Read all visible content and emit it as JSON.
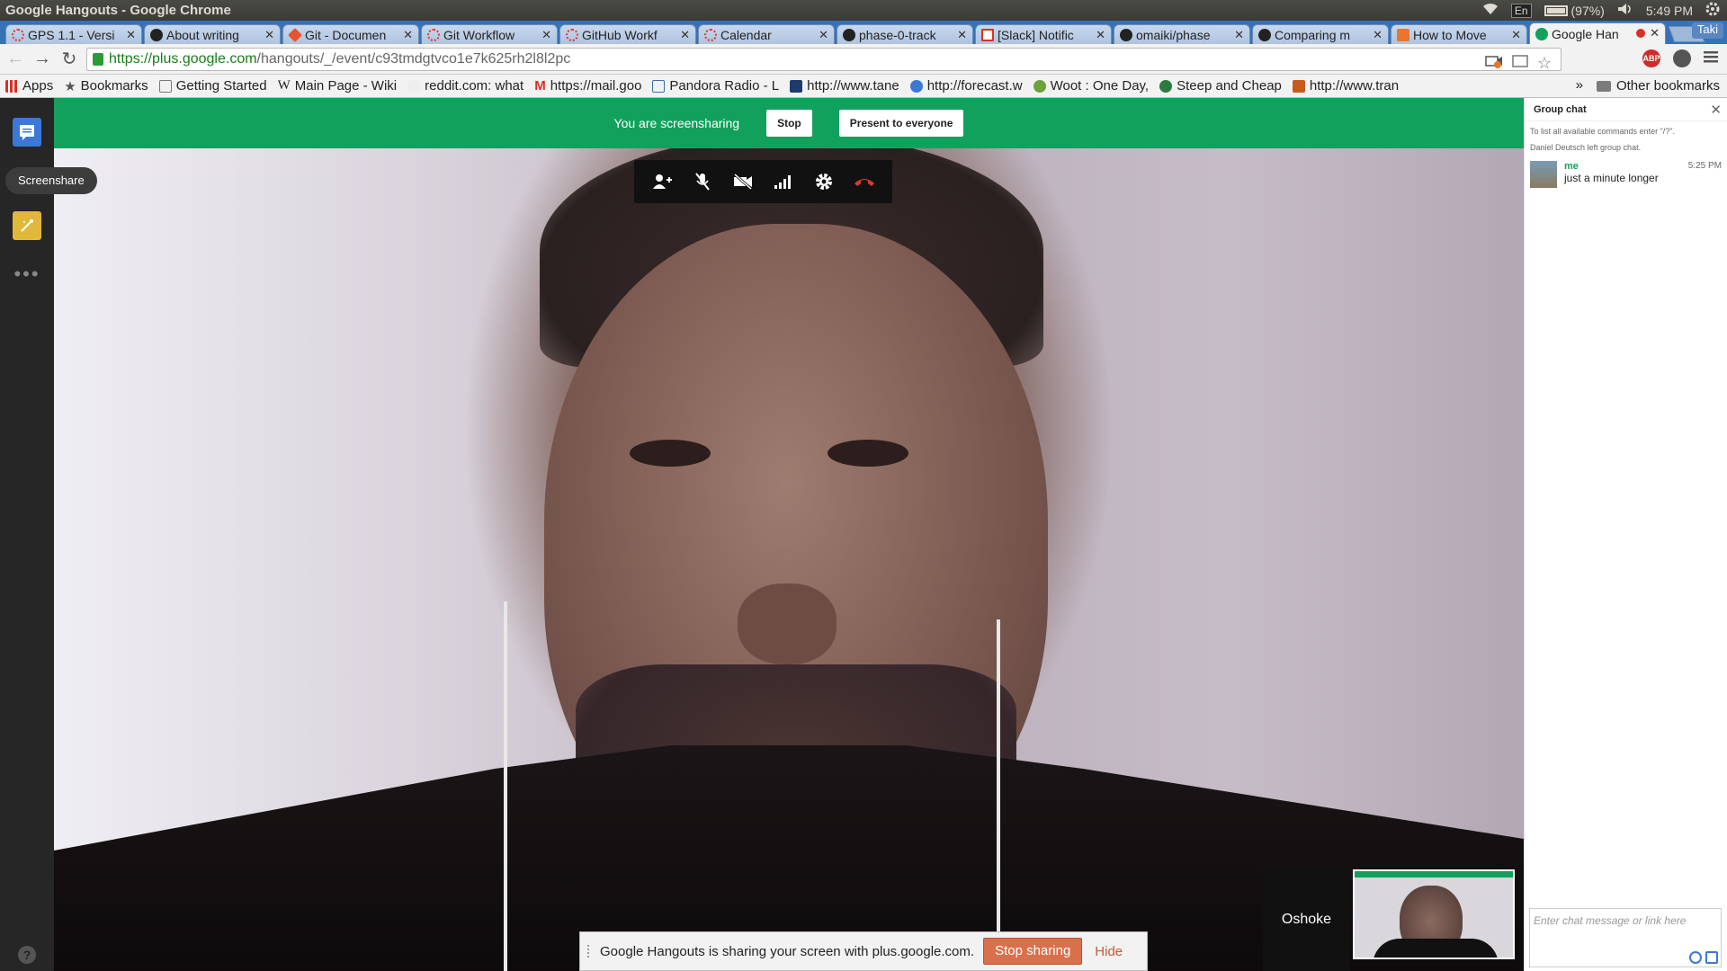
{
  "os": {
    "window_title": "Google Hangouts - Google Chrome",
    "language": "En",
    "battery": "(97%)",
    "clock": "5:49 PM"
  },
  "browser": {
    "tabs": [
      {
        "label": "GPS 1.1 - Versi",
        "color": "#e0392b"
      },
      {
        "label": "About writing",
        "color": "#222222"
      },
      {
        "label": "Git - Documen",
        "color": "#e8532c"
      },
      {
        "label": "Git Workflow",
        "color": "#e0392b"
      },
      {
        "label": "GitHub Workf",
        "color": "#e0392b"
      },
      {
        "label": "Calendar",
        "color": "#e0392b"
      },
      {
        "label": "phase-0-track",
        "color": "#222222"
      },
      {
        "label": "[Slack] Notific",
        "color": "#d93025"
      },
      {
        "label": "omaiki/phase",
        "color": "#222222"
      },
      {
        "label": "Comparing m",
        "color": "#222222"
      },
      {
        "label": "How to Move",
        "color": "#e8772c"
      },
      {
        "label": "Google Han",
        "color": "#12a15c"
      }
    ],
    "profile": "Taki",
    "url_host": "https://plus.google.com",
    "url_path": "/hangouts/_/event/c93tmdgtvco1e7k625rh2l8l2pc",
    "bookmarks": [
      {
        "label": "Apps",
        "icon": "apps-grid-icon"
      },
      {
        "label": "Bookmarks",
        "icon": "star-icon"
      },
      {
        "label": "Getting Started",
        "icon": "page-icon"
      },
      {
        "label": "Main Page - Wiki",
        "icon": "wikipedia-icon"
      },
      {
        "label": "reddit.com: what",
        "icon": "reddit-icon"
      },
      {
        "label": "https://mail.goo",
        "icon": "gmail-icon"
      },
      {
        "label": "Pandora Radio - L",
        "icon": "pandora-icon"
      },
      {
        "label": "http://www.tane",
        "icon": "n-icon"
      },
      {
        "label": "http://forecast.w",
        "icon": "forecast-icon"
      },
      {
        "label": "Woot : One Day,",
        "icon": "woot-icon"
      },
      {
        "label": "Steep and Cheap",
        "icon": "steep-icon"
      },
      {
        "label": "http://www.tran",
        "icon": "translink-icon"
      }
    ],
    "bookmarks_overflow": "»",
    "other_bookmarks": "Other bookmarks"
  },
  "hangout": {
    "tooltip": "Screenshare",
    "share_bar": {
      "text": "You are screensharing",
      "stop_label": "Stop",
      "present_label": "Present to everyone"
    },
    "participant_name": "Oshoke",
    "notification": {
      "text": "Google Hangouts is sharing your screen with plus.google.com.",
      "stop_sharing_label": "Stop sharing",
      "hide_label": "Hide"
    }
  },
  "chat": {
    "title": "Group chat",
    "system_lines": [
      "To list all available commands enter \"/?\".",
      "Daniel Deutsch left group chat."
    ],
    "messages": [
      {
        "sender": "me",
        "time": "5:25 PM",
        "text": "just a minute longer"
      }
    ],
    "input_placeholder": "Enter chat message or link here"
  }
}
